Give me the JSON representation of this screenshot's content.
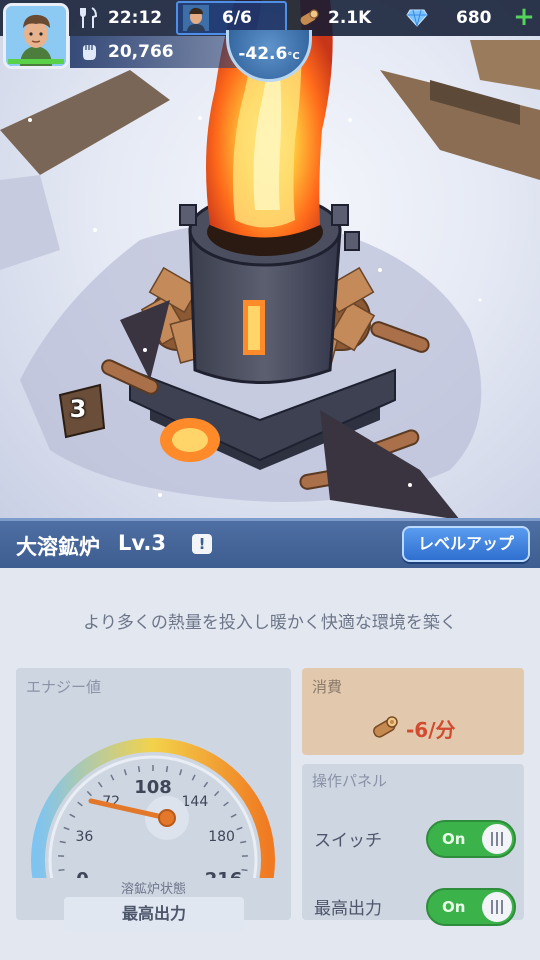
{
  "hud": {
    "time": "22:12",
    "population": "6/6",
    "wood": "2.1K",
    "gems": "680",
    "add_label": "+",
    "power": "20,766",
    "temperature": "-42.6",
    "temperature_unit": "°C",
    "avatar_health": 1.0
  },
  "scene": {
    "plot_number": "3"
  },
  "building": {
    "name": "大溶鉱炉",
    "level": "Lv.3",
    "info_label": "!",
    "level_up_label": "レベルアップ"
  },
  "panel": {
    "description": "より多くの熱量を投入し暖かく快適な環境を築く",
    "energy": {
      "label": "エナジー値",
      "ticks": [
        "0",
        "36",
        "72",
        "108",
        "144",
        "180",
        "216"
      ],
      "min": 0,
      "max": 216,
      "needle_value": 40,
      "status_label": "溶鉱炉状態",
      "status_value": "最高出力"
    },
    "consumption": {
      "label": "消費",
      "value": "-6/分",
      "icon": "log-icon"
    },
    "controls": {
      "label": "操作パネル",
      "switch_label": "スイッチ",
      "switch_state": "On",
      "max_output_label": "最高出力",
      "max_output_state": "On"
    }
  },
  "colors": {
    "hud_bg": "#121c34",
    "title_bar": "#4e6fa3",
    "level_up": "#2f6fd0",
    "toggle_on": "#3bb34a",
    "consume_text": "#d24a2f",
    "gauge_low": "#7fc4f0",
    "gauge_mid": "#f3d24a",
    "gauge_high": "#f07a22"
  }
}
